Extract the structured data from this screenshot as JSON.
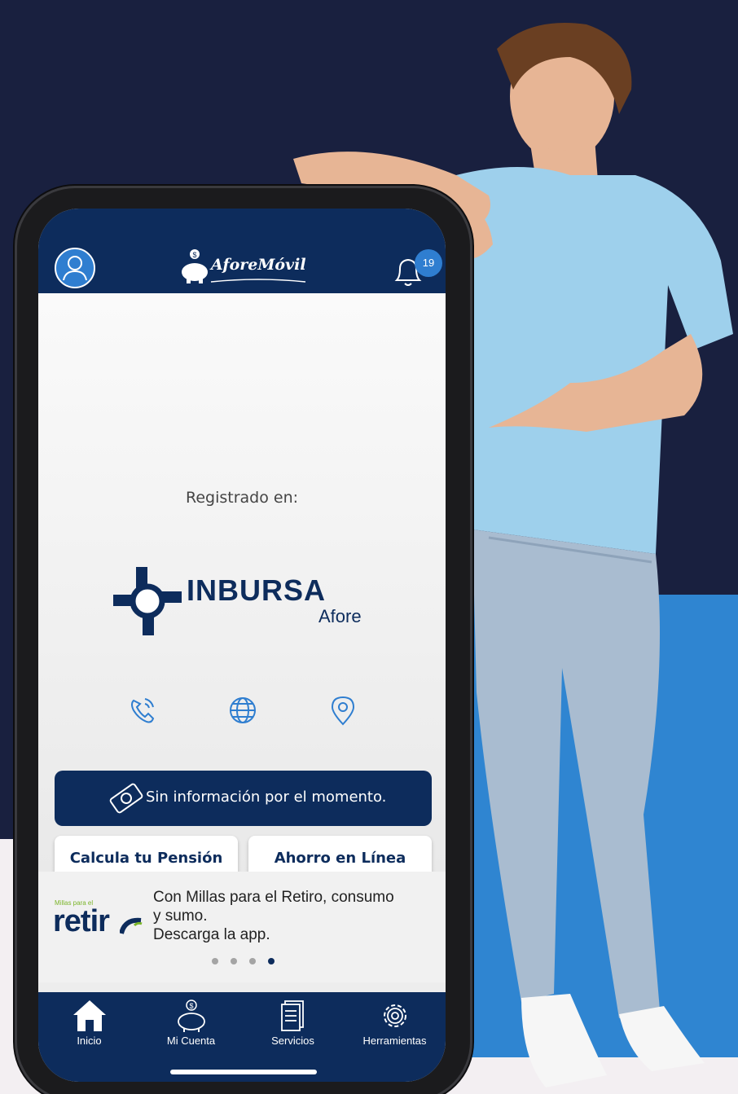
{
  "header": {
    "logo_text": "AforeMóvil",
    "notification_count": "19"
  },
  "main": {
    "registered_label": "Registrado en:",
    "afore_name": "INBURSA",
    "afore_subtitle": "Afore",
    "contact_icons": [
      "phone-icon",
      "globe-icon",
      "location-pin-icon"
    ],
    "info_banner": "Sin información por el momento.",
    "buttons": {
      "calculate": "Calcula tu Pensión",
      "savings": "Ahorro en Línea"
    }
  },
  "promo": {
    "logo_tagline": "Millas para el",
    "logo_word": "retir",
    "text_line1": "Con Millas para el Retiro, consumo",
    "text_line2": "y sumo.",
    "text_line3": "Descarga la app.",
    "dots_total": 4,
    "dots_active": 4
  },
  "nav": {
    "items": [
      {
        "label": "Inicio",
        "icon": "home-icon"
      },
      {
        "label": "Mi Cuenta",
        "icon": "piggy-bank-icon"
      },
      {
        "label": "Servicios",
        "icon": "documents-icon"
      },
      {
        "label": "Herramientas",
        "icon": "gear-icon"
      }
    ]
  },
  "colors": {
    "navy": "#0d2c5c",
    "accent_blue": "#2f7ed0",
    "background_navy": "#19203f",
    "background_blue": "#2f85d1"
  }
}
